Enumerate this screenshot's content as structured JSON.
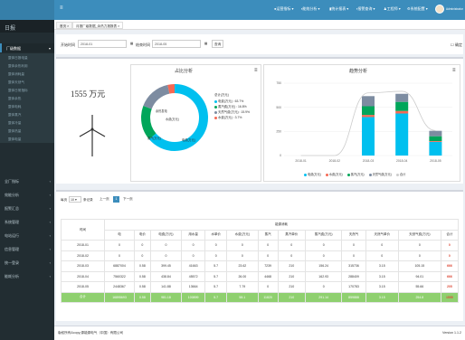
{
  "header": {
    "menu_items": [
      "●运营指标 ▾",
      "▪能效分析 ▾",
      "▮统计报表 ▾",
      "▪报警查询 ▾",
      "♟工程师 ▾",
      "⚙系统配置 ▾"
    ],
    "user_name": "Administrator"
  },
  "sidebar": {
    "title": "日报",
    "items": [
      {
        "label": "厂级数据",
        "active": true
      },
      {
        "label": "全厂指标"
      },
      {
        "label": "效能分析"
      },
      {
        "label": "报警汇总"
      },
      {
        "label": "系统管理"
      },
      {
        "label": "电站运行"
      },
      {
        "label": "信息管理"
      },
      {
        "label": "统一登录"
      },
      {
        "label": "能耗分析"
      }
    ],
    "subitems": [
      "整体日报电量",
      "整体余热利用",
      "整体消耗量",
      "整体天然气",
      "整体日常指标",
      "整体余热",
      "整体电耗",
      "整体蒸汽",
      "整体冷量",
      "整体热量",
      "整体电量"
    ]
  },
  "tabs": [
    {
      "label": "首页 ×"
    },
    {
      "label": "月报厂级数据_余热力报报表 ×"
    }
  ],
  "filter": {
    "start_label": "开始时间",
    "start_value": "2018-01",
    "end_label": "结束时间",
    "end_value": "2018-05",
    "query_button": "查询",
    "confirm_label": "确定"
  },
  "kpi": {
    "value": "1555 万元"
  },
  "donut": {
    "title": "占比分析",
    "center_top": "余热发电",
    "legend_title": "总计(万元)",
    "legend": [
      {
        "label": "电费(万元) : 63.7%",
        "color": "#00c0ef"
      },
      {
        "label": "蒸汽费(万元) : 16.8%",
        "color": "#00a65a"
      },
      {
        "label": "天然气费(万元) : 15.9%",
        "color": "#7d8ca1"
      },
      {
        "label": "水费(万元) : 3.7%",
        "color": "#f56954"
      }
    ],
    "slice_labels": [
      "水费(万元)",
      "电费(万元)",
      "蒸汽(万元)"
    ]
  },
  "chart_data": {
    "type": "bar",
    "title": "趋势分析",
    "categories": [
      "2018-01",
      "2018-02",
      "2018-03",
      "2018-04",
      "2018-05"
    ],
    "ylim": [
      0,
      750
    ],
    "yticks": [
      0,
      250,
      500,
      750
    ],
    "series": [
      {
        "name": "电费(万元)",
        "color": "#00c0ef",
        "values": [
          0,
          0,
          399,
          436,
          142
        ]
      },
      {
        "name": "水费(万元)",
        "color": "#f56954",
        "values": [
          0,
          0,
          22,
          26,
          8
        ]
      },
      {
        "name": "蒸汽(万元)",
        "color": "#00a65a",
        "values": [
          0,
          0,
          90,
          94,
          50
        ]
      },
      {
        "name": "天然气费(万元)",
        "color": "#7d8ca1",
        "values": [
          0,
          0,
          105,
          84,
          56
        ]
      }
    ],
    "line": {
      "name": "合计",
      "values": [
        0,
        0,
        649,
        666,
        259
      ]
    },
    "legend_position": "bottom",
    "grid": true
  },
  "table": {
    "show_label": "每页",
    "show_value": "10",
    "show_suffix": "条记录",
    "prev": "上一页",
    "page": "1",
    "next": "下一页",
    "group_header": "能源消耗",
    "time_header": "时间",
    "columns": [
      "电",
      "电价",
      "电费(万元)",
      "用水量",
      "水单价",
      "水费(万元)",
      "蒸汽",
      "蒸汽单价",
      "蒸汽费(万元)",
      "天然气",
      "天然气单价",
      "天然气费(万元)",
      "合计"
    ],
    "rows": [
      [
        "2018-01",
        "0",
        "0",
        "0",
        "0",
        "0",
        "0",
        "0",
        "0",
        "0",
        "0",
        "0",
        "0",
        "0"
      ],
      [
        "2018-02",
        "0",
        "0",
        "0",
        "0",
        "0",
        "0",
        "0",
        "0",
        "0",
        "0",
        "0",
        "0",
        "0"
      ],
      [
        "2018-03",
        "6887004",
        "0.58",
        "399.45",
        "41663",
        "5.7",
        "23.62",
        "7239",
        "210",
        "156.24",
        "315736",
        "3.15",
        "105.15",
        "666"
      ],
      [
        "2018-04",
        "7560322",
        "0.58",
        "438.84",
        "45572",
        "5.7",
        "26.00",
        "4468",
        "210",
        "162.93",
        "288409",
        "3.15",
        "94.01",
        "666"
      ],
      [
        "2018-05",
        "2448367",
        "0.58",
        "141.88",
        "13664",
        "5.7",
        "7.79",
        "0",
        "210",
        "0",
        "170783",
        "3.15",
        "55.66",
        "205"
      ]
    ],
    "total": [
      "合计",
      "16895693",
      "0.58",
      "981.18",
      "100899",
      "5.7",
      "58.1",
      "11820",
      "210",
      "291.14",
      "859888",
      "3.15",
      "254.8",
      "1555"
    ]
  },
  "footer": {
    "copyright": "版权所有&copy;源能源电气（中国）有限公司",
    "version": "Version 1.1.2"
  }
}
